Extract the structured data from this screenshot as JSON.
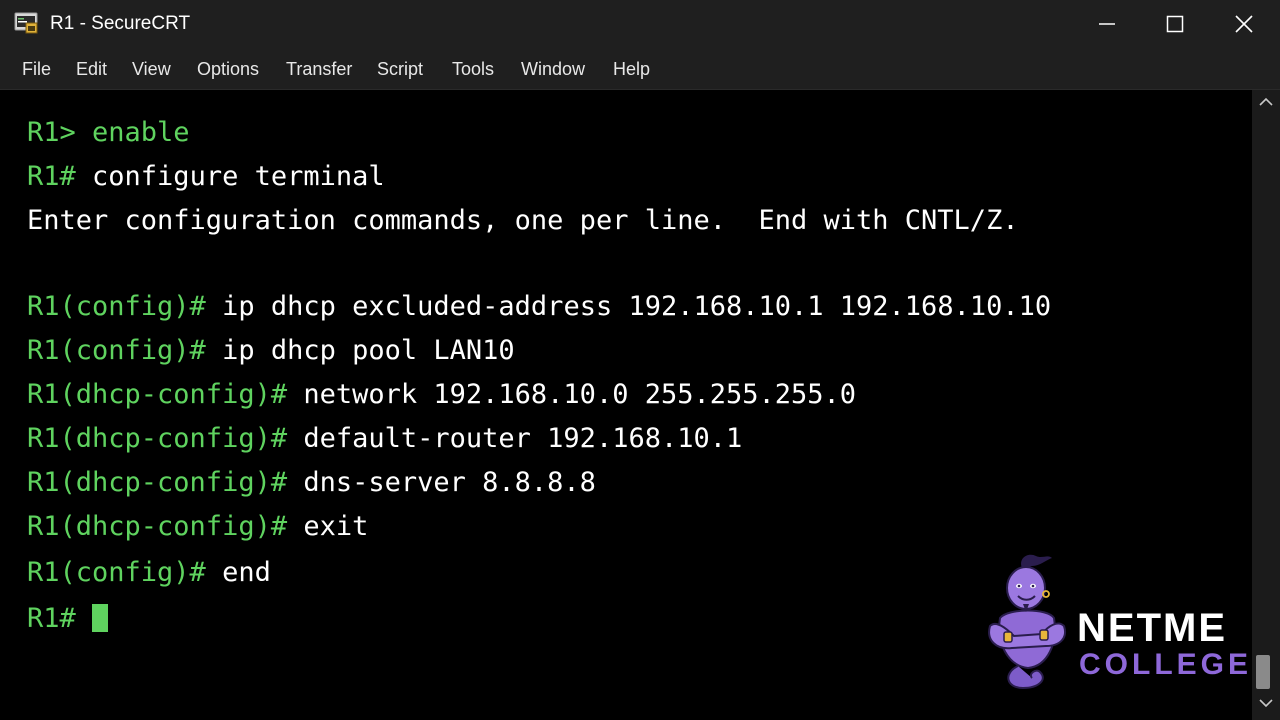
{
  "window": {
    "title": "R1 - SecureCRT",
    "app_icon": "securecrt-icon",
    "controls": {
      "minimize_icon": "minimize-icon",
      "maximize_icon": "maximize-icon",
      "close_icon": "close-icon"
    }
  },
  "menu": {
    "items": [
      "File",
      "Edit",
      "View",
      "Options",
      "Transfer",
      "Script",
      "Tools",
      "Window",
      "Help"
    ]
  },
  "terminal": {
    "colors": {
      "background": "#000000",
      "prompt": "#5fd35f",
      "text": "#ffffff",
      "cursor": "#5fd35f"
    },
    "lines": [
      {
        "prompt": "R1> ",
        "command": "enable"
      },
      {
        "prompt": "R1# ",
        "command": "configure terminal"
      },
      {
        "prompt": "",
        "command": "Enter configuration commands, one per line.  End with CNTL/Z."
      },
      {
        "prompt": "R1(config)# ",
        "command": "ip dhcp excluded-address 192.168.10.1 192.168.10.10"
      },
      {
        "prompt": "R1(config)# ",
        "command": "ip dhcp pool LAN10"
      },
      {
        "prompt": "R1(dhcp-config)# ",
        "command": "network 192.168.10.0 255.255.255.0"
      },
      {
        "prompt": "R1(dhcp-config)# ",
        "command": "default-router 192.168.10.1"
      },
      {
        "prompt": "R1(dhcp-config)# ",
        "command": "dns-server 8.8.8.8"
      },
      {
        "prompt": "R1(dhcp-config)# ",
        "command": "exit"
      },
      {
        "prompt": "R1(config)# ",
        "command": "end"
      },
      {
        "prompt": "R1# ",
        "command": ""
      }
    ]
  },
  "scrollbar": {
    "up_icon": "chevron-up-icon",
    "down_icon": "chevron-down-icon",
    "position": 1.0
  },
  "watermark": {
    "icon": "genie-mascot-icon",
    "line1": "NETME",
    "line2": "COLLEGE",
    "colors": {
      "line1": "#ffffff",
      "line2": "#8e68d9"
    }
  }
}
